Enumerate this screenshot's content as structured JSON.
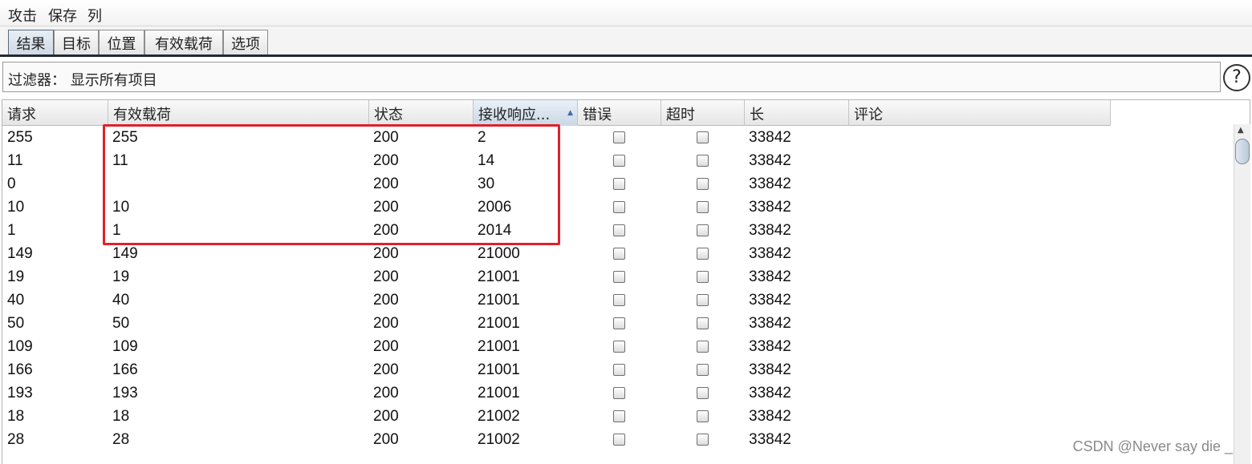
{
  "menubar": {
    "attack": "攻击",
    "save": "保存",
    "columns": "列"
  },
  "tabs": [
    "结果",
    "目标",
    "位置",
    "有效载荷",
    "选项"
  ],
  "active_tab": "结果",
  "filter": {
    "text": "过滤器： 显示所有项目"
  },
  "help": {
    "label": "?"
  },
  "columns": [
    "请求",
    "有效载荷",
    "状态",
    "接收响应...",
    "错误",
    "超时",
    "长",
    "评论"
  ],
  "sorted_column": "接收响应...",
  "sort_arrow": "▲",
  "scroll_up": "▲",
  "rows": [
    {
      "request": "255",
      "payload": "255",
      "status": "200",
      "received": "2",
      "error": false,
      "timeout": false,
      "length": "33842",
      "comment": ""
    },
    {
      "request": "11",
      "payload": "11",
      "status": "200",
      "received": "14",
      "error": false,
      "timeout": false,
      "length": "33842",
      "comment": ""
    },
    {
      "request": "0",
      "payload": "",
      "status": "200",
      "received": "30",
      "error": false,
      "timeout": false,
      "length": "33842",
      "comment": ""
    },
    {
      "request": "10",
      "payload": "10",
      "status": "200",
      "received": "2006",
      "error": false,
      "timeout": false,
      "length": "33842",
      "comment": ""
    },
    {
      "request": "1",
      "payload": "1",
      "status": "200",
      "received": "2014",
      "error": false,
      "timeout": false,
      "length": "33842",
      "comment": ""
    },
    {
      "request": "149",
      "payload": "149",
      "status": "200",
      "received": "21000",
      "error": false,
      "timeout": false,
      "length": "33842",
      "comment": ""
    },
    {
      "request": "19",
      "payload": "19",
      "status": "200",
      "received": "21001",
      "error": false,
      "timeout": false,
      "length": "33842",
      "comment": ""
    },
    {
      "request": "40",
      "payload": "40",
      "status": "200",
      "received": "21001",
      "error": false,
      "timeout": false,
      "length": "33842",
      "comment": ""
    },
    {
      "request": "50",
      "payload": "50",
      "status": "200",
      "received": "21001",
      "error": false,
      "timeout": false,
      "length": "33842",
      "comment": ""
    },
    {
      "request": "109",
      "payload": "109",
      "status": "200",
      "received": "21001",
      "error": false,
      "timeout": false,
      "length": "33842",
      "comment": ""
    },
    {
      "request": "166",
      "payload": "166",
      "status": "200",
      "received": "21001",
      "error": false,
      "timeout": false,
      "length": "33842",
      "comment": ""
    },
    {
      "request": "193",
      "payload": "193",
      "status": "200",
      "received": "21001",
      "error": false,
      "timeout": false,
      "length": "33842",
      "comment": ""
    },
    {
      "request": "18",
      "payload": "18",
      "status": "200",
      "received": "21002",
      "error": false,
      "timeout": false,
      "length": "33842",
      "comment": ""
    },
    {
      "request": "28",
      "payload": "28",
      "status": "200",
      "received": "21002",
      "error": false,
      "timeout": false,
      "length": "33842",
      "comment": ""
    }
  ],
  "annotation_color": "#e0202a",
  "watermark": "CSDN @Never say die _"
}
